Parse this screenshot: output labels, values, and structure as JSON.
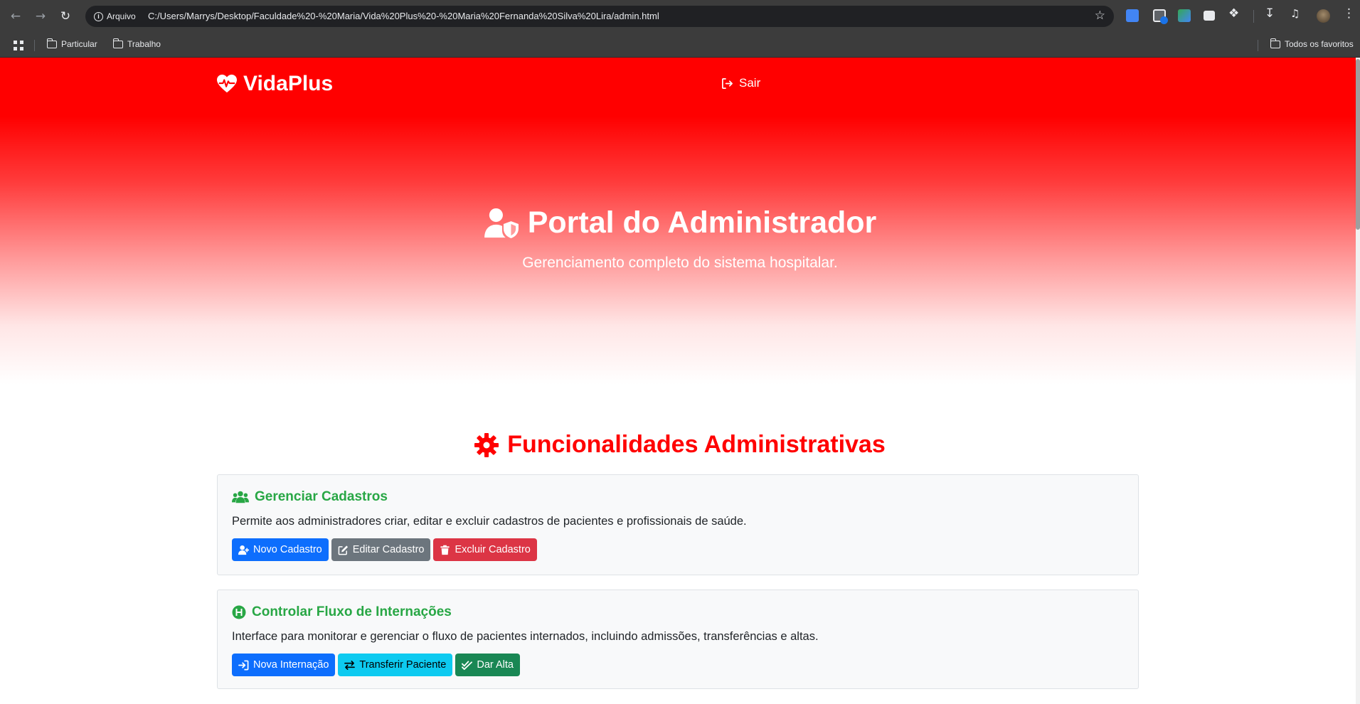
{
  "browser": {
    "site_chip": "Arquivo",
    "url": "C:/Users/Marrys/Desktop/Faculdade%20-%20Maria/Vida%20Plus%20-%20Maria%20Fernanda%20Silva%20Lira/admin.html",
    "bookmarks": [
      "Particular",
      "Trabalho"
    ],
    "all_bookmarks": "Todos os favoritos"
  },
  "header": {
    "brand": "VidaPlus",
    "logout": "Sair"
  },
  "hero": {
    "title": "Portal do Administrador",
    "subtitle": "Gerenciamento completo do sistema hospitalar."
  },
  "section": {
    "title": "Funcionalidades Administrativas"
  },
  "cards": [
    {
      "title": "Gerenciar Cadastros",
      "description": "Permite aos administradores criar, editar e excluir cadastros de pacientes e profissionais de saúde.",
      "buttons": [
        {
          "label": "Novo Cadastro",
          "icon": "user-plus-icon"
        },
        {
          "label": "Editar Cadastro",
          "icon": "edit-icon"
        },
        {
          "label": "Excluir Cadastro",
          "icon": "trash-icon"
        }
      ]
    },
    {
      "title": "Controlar Fluxo de Internações",
      "description": "Interface para monitorar e gerenciar o fluxo de pacientes internados, incluindo admissões, transferências e altas.",
      "buttons": [
        {
          "label": "Nova Internação",
          "icon": "sign-in-icon"
        },
        {
          "label": "Transferir Paciente",
          "icon": "exchange-icon"
        },
        {
          "label": "Dar Alta",
          "icon": "check-double-icon"
        }
      ]
    }
  ],
  "colors": {
    "brand_red": "#ff0000",
    "card_title_green": "#28a745",
    "btn_primary": "#0d6efd",
    "btn_secondary": "#6c757d",
    "btn_danger": "#dc3545",
    "btn_info": "#0dcaf0",
    "btn_success": "#198754"
  }
}
